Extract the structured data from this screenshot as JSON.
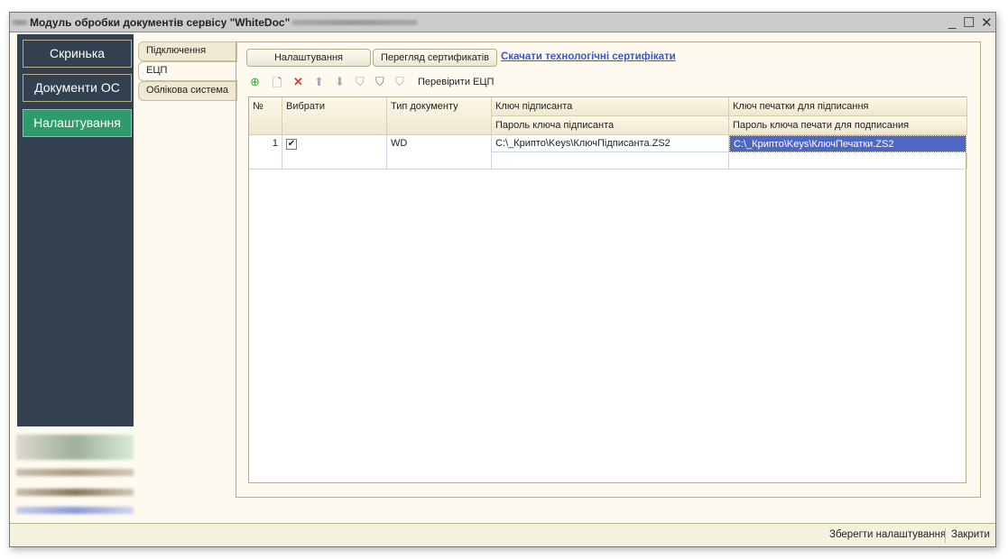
{
  "window": {
    "title": "Модуль обробки документів сервісу \"WhiteDoc\""
  },
  "sidebar": {
    "items": [
      {
        "label": "Скринька"
      },
      {
        "label": "Документи ОС"
      },
      {
        "label": "Налаштування"
      }
    ]
  },
  "tabs": [
    {
      "label": "Підключення"
    },
    {
      "label": "ЕЦП"
    },
    {
      "label": "Облікова система"
    }
  ],
  "panel": {
    "settings_btn": "Налаштування",
    "certs_btn": "Перегляд сертификатів",
    "download_link": "Скачати технологічні сертифікати",
    "check_label": "Перевірити ЕЦП"
  },
  "table": {
    "headers": {
      "num": "№",
      "select": "Вибрати",
      "doc_type": "Тип документу",
      "signer_key": "Ключ підписанта",
      "signer_pass": "Пароль ключа підписанта",
      "seal_key": "Ключ печатки для підписання",
      "seal_pass": "Пароль ключа печати для подписания"
    },
    "rows": [
      {
        "num": "1",
        "selected": true,
        "doc_type": "WD",
        "signer_key": "C:\\_Крипто\\Keys\\КлючПідписанта.ZS2",
        "signer_pass": "",
        "seal_key": "C:\\_Крипто\\Keys\\КлючПечатки.ZS2",
        "seal_pass": ""
      }
    ]
  },
  "status": {
    "save": "Зберегти налаштування",
    "close": "Закрити"
  }
}
